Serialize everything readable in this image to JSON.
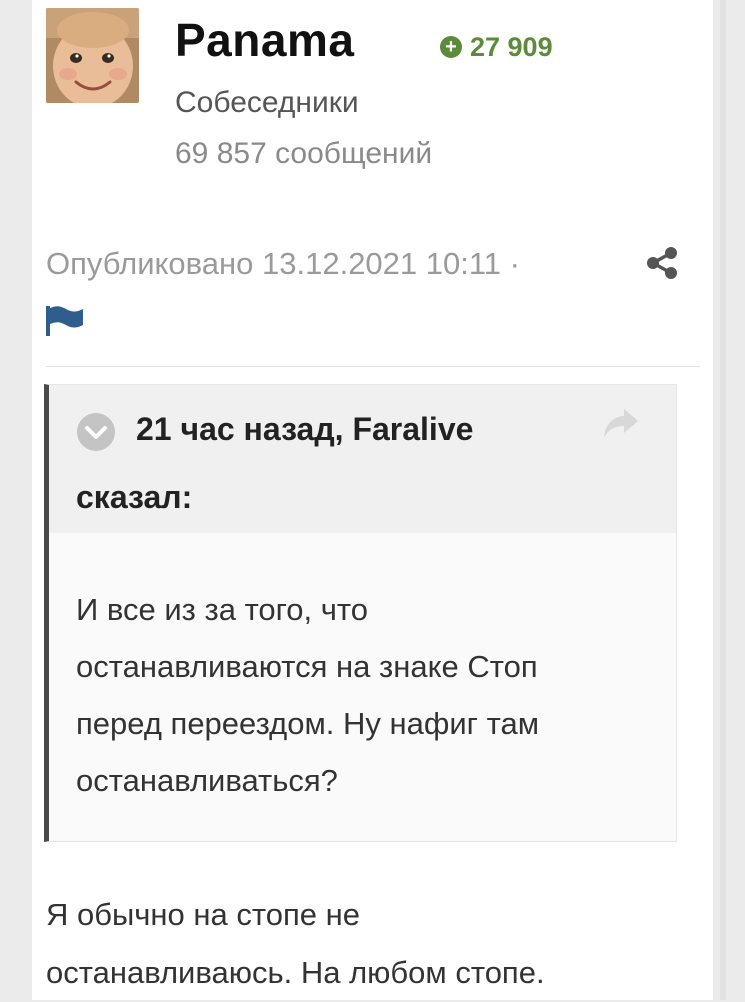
{
  "author": {
    "name": "Panama",
    "reputation": "27 909",
    "group": "Собеседники",
    "post_count": "69 857 сообщений",
    "avatar_icon": "baby-face-avatar"
  },
  "meta": {
    "published": "Опубликовано 13.12.2021 10:11 ·"
  },
  "icons": {
    "share": "share-icon",
    "report": "flag-icon",
    "quote_toggle": "chevron-down-icon",
    "quote_reply": "reply-arrow-icon"
  },
  "colors": {
    "reputation": "#5b8b3b",
    "flag": "#2f5e8e",
    "quote_border": "#4a4a4a"
  },
  "quote": {
    "header_line1": "21 час назад, Faralive",
    "header_line2": "сказал:",
    "lines": [
      "И все из за того, что",
      "останавливаются на знаке Стоп",
      "перед переездом. Ну нафиг там",
      "останавливаться?"
    ]
  },
  "post": {
    "lines": [
      "Я обычно на стопе не",
      "останавливаюсь. На любом стопе."
    ]
  }
}
